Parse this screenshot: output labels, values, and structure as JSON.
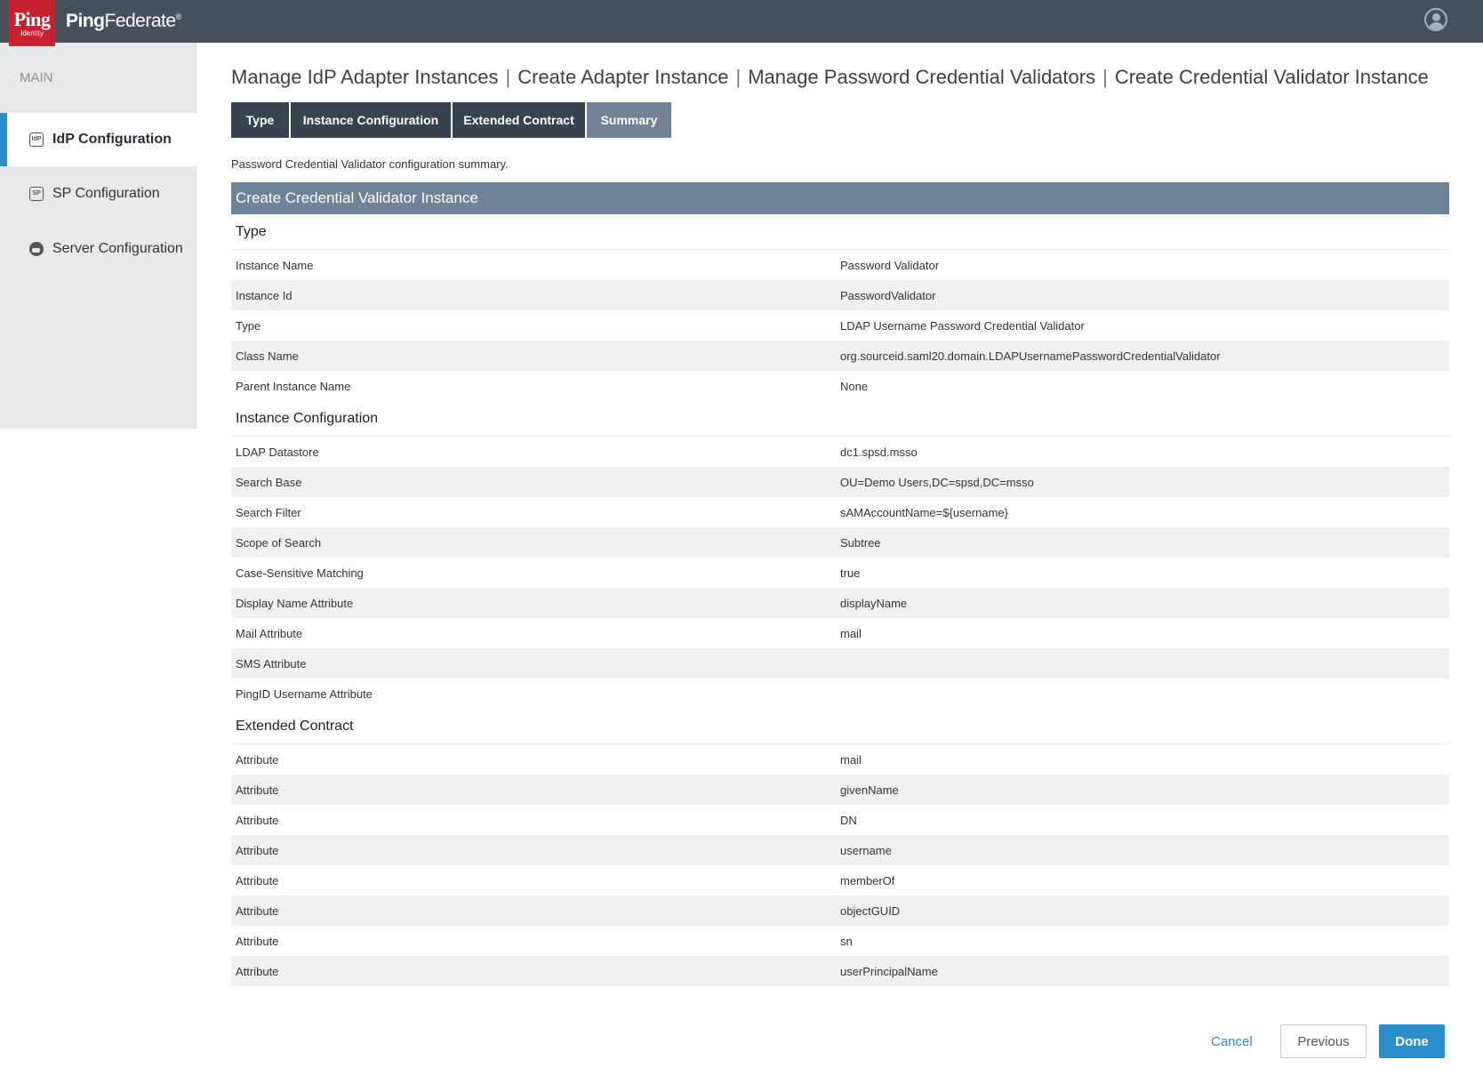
{
  "header": {
    "logo_text": "Ping",
    "logo_subtext": "Identity",
    "product_bold": "Ping",
    "product_light": "Federate",
    "product_mark": "®",
    "user_icon": "user-circle-icon"
  },
  "sidebar": {
    "heading": "MAIN",
    "items": [
      {
        "label": "IdP Configuration",
        "icon": "idp-icon",
        "icon_text": "IdP",
        "active": true
      },
      {
        "label": "SP Configuration",
        "icon": "sp-icon",
        "icon_text": "SP",
        "active": false
      },
      {
        "label": "Server Configuration",
        "icon": "server-icon",
        "icon_text": "",
        "active": false
      }
    ]
  },
  "breadcrumb": [
    "Manage IdP Adapter Instances",
    "Create Adapter Instance",
    "Manage Password Credential Validators",
    "Create Credential Validator Instance"
  ],
  "breadcrumb_separator": "|",
  "tabs": [
    {
      "label": "Type",
      "active": false
    },
    {
      "label": "Instance Configuration",
      "active": false
    },
    {
      "label": "Extended Contract",
      "active": false
    },
    {
      "label": "Summary",
      "active": true
    }
  ],
  "intro_text": "Password Credential Validator configuration summary.",
  "summary": {
    "header": "Create Credential Validator Instance",
    "sections": [
      {
        "title": "Type",
        "rows": [
          [
            "Instance Name",
            "Password Validator"
          ],
          [
            "Instance Id",
            "PasswordValidator"
          ],
          [
            "Type",
            "LDAP Username Password Credential Validator"
          ],
          [
            "Class Name",
            "org.sourceid.saml20.domain.LDAPUsernamePasswordCredentialValidator"
          ],
          [
            "Parent Instance Name",
            "None"
          ]
        ]
      },
      {
        "title": "Instance Configuration",
        "rows": [
          [
            "LDAP Datastore",
            "dc1.spsd.msso"
          ],
          [
            "Search Base",
            "OU=Demo Users,DC=spsd,DC=msso"
          ],
          [
            "Search Filter",
            "sAMAccountName=${username}"
          ],
          [
            "Scope of Search",
            "Subtree"
          ],
          [
            "Case-Sensitive Matching",
            "true"
          ],
          [
            "Display Name Attribute",
            "displayName"
          ],
          [
            "Mail Attribute",
            "mail"
          ],
          [
            "SMS Attribute",
            ""
          ],
          [
            "PingID Username Attribute",
            ""
          ]
        ]
      },
      {
        "title": "Extended Contract",
        "rows": [
          [
            "Attribute",
            "mail"
          ],
          [
            "Attribute",
            "givenName"
          ],
          [
            "Attribute",
            "DN"
          ],
          [
            "Attribute",
            "username"
          ],
          [
            "Attribute",
            "memberOf"
          ],
          [
            "Attribute",
            "objectGUID"
          ],
          [
            "Attribute",
            "sn"
          ],
          [
            "Attribute",
            "userPrincipalName"
          ]
        ]
      }
    ]
  },
  "buttons": {
    "cancel": "Cancel",
    "previous": "Previous",
    "done": "Done"
  },
  "colors": {
    "topbar": "#474f5a",
    "brand_red": "#c8212f",
    "accent_blue": "#2c8ecb",
    "tab_dark": "#38434f",
    "tab_active": "#718294",
    "summary_header": "#6f8398"
  }
}
